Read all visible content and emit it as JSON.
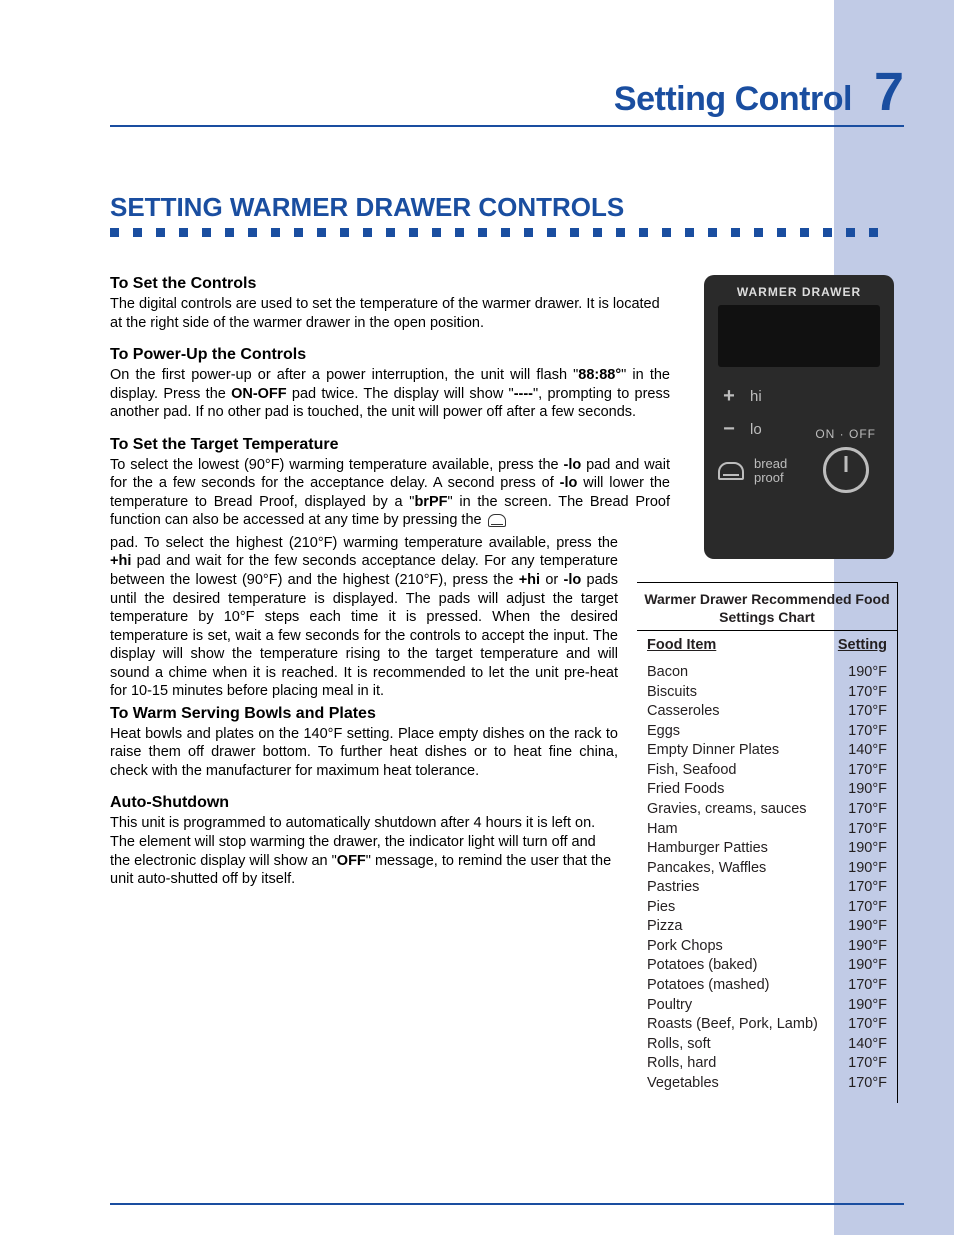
{
  "header": {
    "title": "Setting Control",
    "page": "7"
  },
  "subheading": "SETTING WARMER DRAWER CONTROLS",
  "sections": {
    "s1": {
      "h": "To Set the Controls",
      "p": "The digital controls are used to set the temperature of the warmer drawer. It is located at the right side of the warmer drawer in the open position."
    },
    "s2": {
      "h": "To Power-Up the Controls",
      "p_a": "On the first power-up or after  a power interruption, the unit will flash \"",
      "b1": "88:88°",
      "p_b": "\" in the display. Press the ",
      "b2": "ON-OFF",
      "p_c": " pad twice. The display will show \"",
      "b3": "----",
      "p_d": "\", prompting to press another pad. If no other pad is touched, the unit will power off after a few seconds."
    },
    "s3": {
      "h": "To Set the Target Temperature",
      "p1_a": "To select the lowest (90°F) warming temperature available, press the ",
      "b1": "-lo",
      "p1_b": " pad and wait for the a few seconds for the acceptance delay. A second press of ",
      "b2": "-lo",
      "p1_c": " will lower the temperature to Bread Proof, displayed by a \"",
      "b3": "brPF",
      "p1_d": "\" in the screen. The Bread Proof function can also be accessed at any time by pressing the ",
      "p2_a": "pad. To select the highest (210°F) warming temperature available, press the ",
      "b4": "+hi",
      "p2_b": " pad and wait for the few seconds acceptance delay. For any temperature between the lowest (90°F) and the highest (210°F), press the ",
      "b5": "+hi",
      "p2_c": " or ",
      "b6": "-lo",
      "p2_d": " pads until the desired temperature is displayed. The pads will adjust the target temperature by 10°F steps each time it is pressed. When the desired temperature is set, wait a few seconds for the controls to accept the input. The display will show the temperature rising to the target temperature and will sound a chime when it is reached. It is recommended to let the unit pre-heat for 10-15 minutes before placing meal in it."
    },
    "s4": {
      "h": "To Warm Serving Bowls and Plates",
      "p": "Heat bowls and plates on the 140°F setting. Place empty dishes on the rack to raise them off drawer bottom. To further heat dishes or to heat fine china, check with the manufacturer for maximum heat tolerance."
    },
    "s5": {
      "h": "Auto-Shutdown",
      "p_a": "This unit is programmed to automatically shutdown after 4 hours it is left on. The element will stop warming the drawer, the indicator light will turn off and the electronic display will show an \"",
      "b1": "OFF",
      "p_b": "\" message, to remind the user that the unit auto-shutted off by itself."
    }
  },
  "panel": {
    "caption": "WARMER DRAWER",
    "hi": "hi",
    "lo": "lo",
    "onoff": "ON · OFF",
    "bp1": "bread",
    "bp2": "proof"
  },
  "chart_data": {
    "type": "table",
    "title": "Warmer Drawer Recommended Food Settings Chart",
    "headers": {
      "c1": "Food Item",
      "c2": "Setting"
    },
    "rows": [
      {
        "item": "Bacon",
        "setting": "190°F"
      },
      {
        "item": "Biscuits",
        "setting": "170°F"
      },
      {
        "item": "Casseroles",
        "setting": "170°F"
      },
      {
        "item": "Eggs",
        "setting": "170°F"
      },
      {
        "item": "Empty Dinner Plates",
        "setting": "140°F"
      },
      {
        "item": "Fish, Seafood",
        "setting": "170°F"
      },
      {
        "item": "Fried Foods",
        "setting": "190°F"
      },
      {
        "item": "Gravies, creams, sauces",
        "setting": "170°F"
      },
      {
        "item": "Ham",
        "setting": "170°F"
      },
      {
        "item": "Hamburger Patties",
        "setting": "190°F"
      },
      {
        "item": "Pancakes, Waffles",
        "setting": "190°F"
      },
      {
        "item": "Pastries",
        "setting": "170°F"
      },
      {
        "item": "Pies",
        "setting": "170°F"
      },
      {
        "item": "Pizza",
        "setting": "190°F"
      },
      {
        "item": "Pork Chops",
        "setting": "190°F"
      },
      {
        "item": "Potatoes (baked)",
        "setting": "190°F"
      },
      {
        "item": "Potatoes (mashed)",
        "setting": "170°F"
      },
      {
        "item": "Poultry",
        "setting": "190°F"
      },
      {
        "item": "Roasts (Beef, Pork, Lamb)",
        "setting": "170°F"
      },
      {
        "item": "Rolls, soft",
        "setting": "140°F"
      },
      {
        "item": "Rolls, hard",
        "setting": "170°F"
      },
      {
        "item": "Vegetables",
        "setting": "170°F"
      }
    ]
  }
}
